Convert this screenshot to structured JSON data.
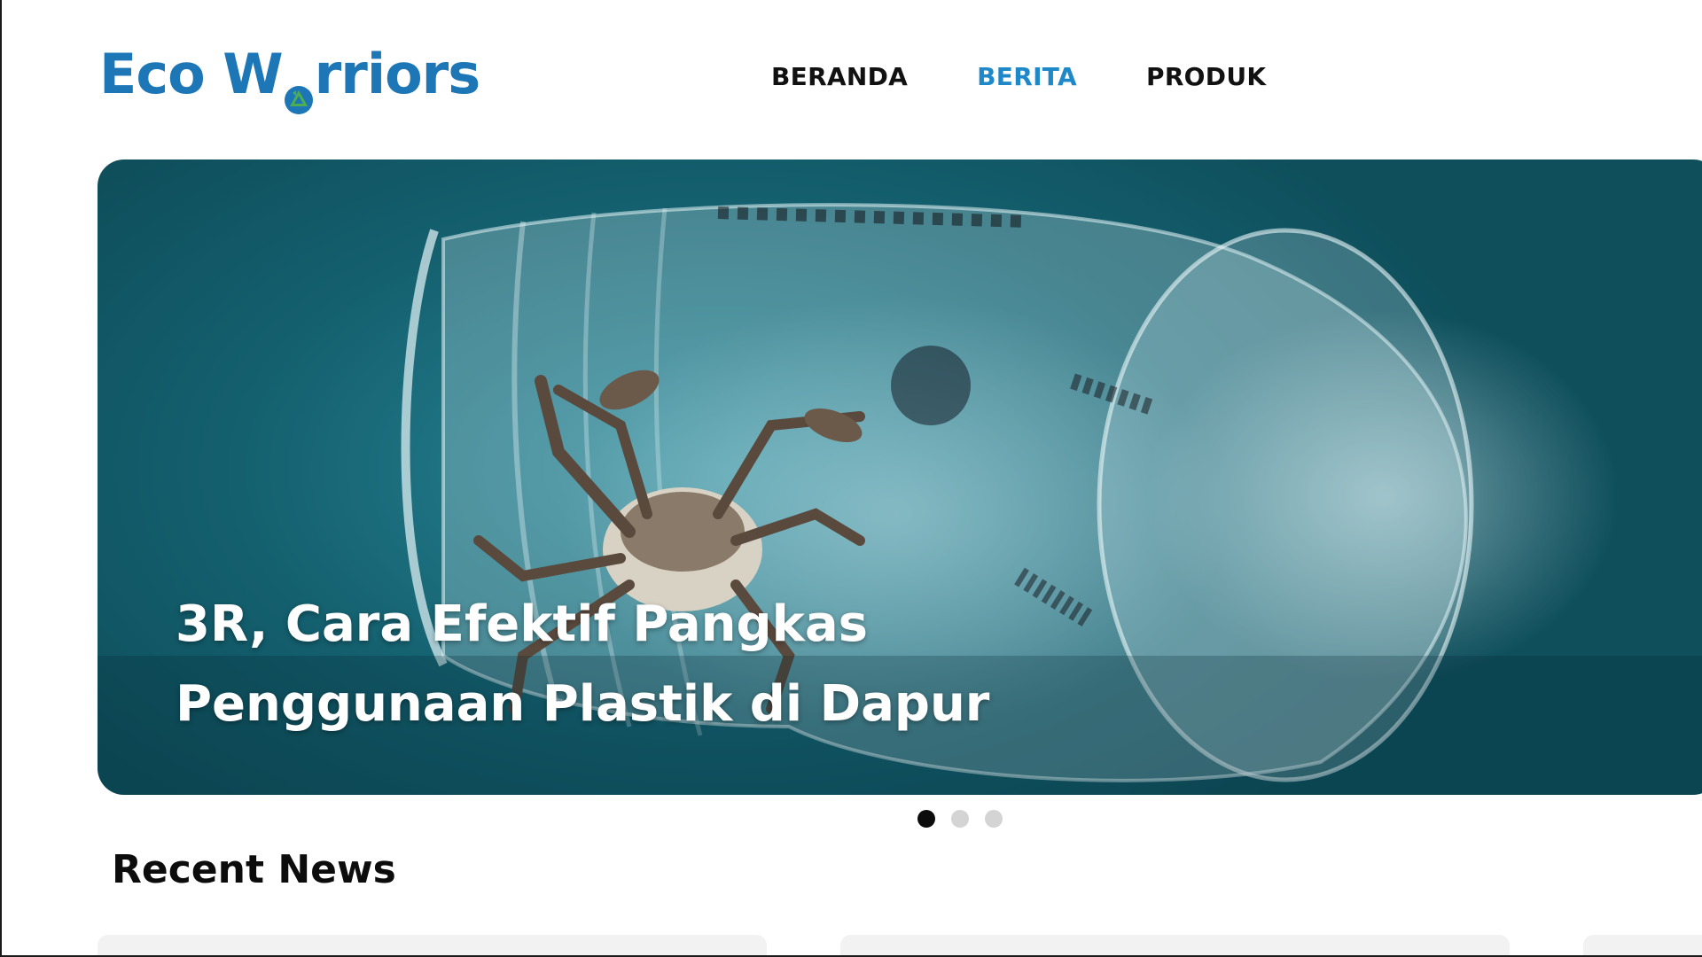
{
  "header": {
    "logo_text_left": "Eco W",
    "logo_text_right": "rriors",
    "brand_color": "#1d77b6",
    "nav": [
      {
        "label": "BERANDA",
        "active": false
      },
      {
        "label": "BERITA",
        "active": true
      },
      {
        "label": "PRODUK",
        "active": false
      }
    ],
    "active_color": "#1e88c9"
  },
  "hero": {
    "title_line1": "3R, Cara Efektif Pangkas",
    "title_line2": "Penggunaan Plastik di Dapur",
    "slides_total": 3,
    "active_slide": 1
  },
  "recent": {
    "title": "Recent News"
  },
  "icons": {
    "logo_o": "recycle-icon"
  }
}
